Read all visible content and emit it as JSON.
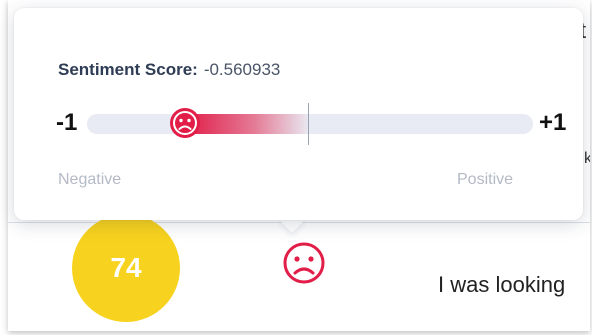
{
  "tooltip": {
    "score_label": "Sentiment Score:",
    "score_value": "-0.560933",
    "scale_min": "-1",
    "scale_max": "+1",
    "negative_label": "Negative",
    "positive_label": "Positive",
    "sentiment": -0.560933,
    "marker_icon": "sad-face-icon"
  },
  "row": {
    "score": "74",
    "sentiment_icon": "sad-face-icon",
    "text": "I was looking"
  },
  "background": {
    "fragment_top": "t",
    "fragment_mid": "k"
  },
  "colors": {
    "negative": "#e11d48",
    "score_circle": "#f7d21e",
    "track": "#e8ebf3"
  }
}
